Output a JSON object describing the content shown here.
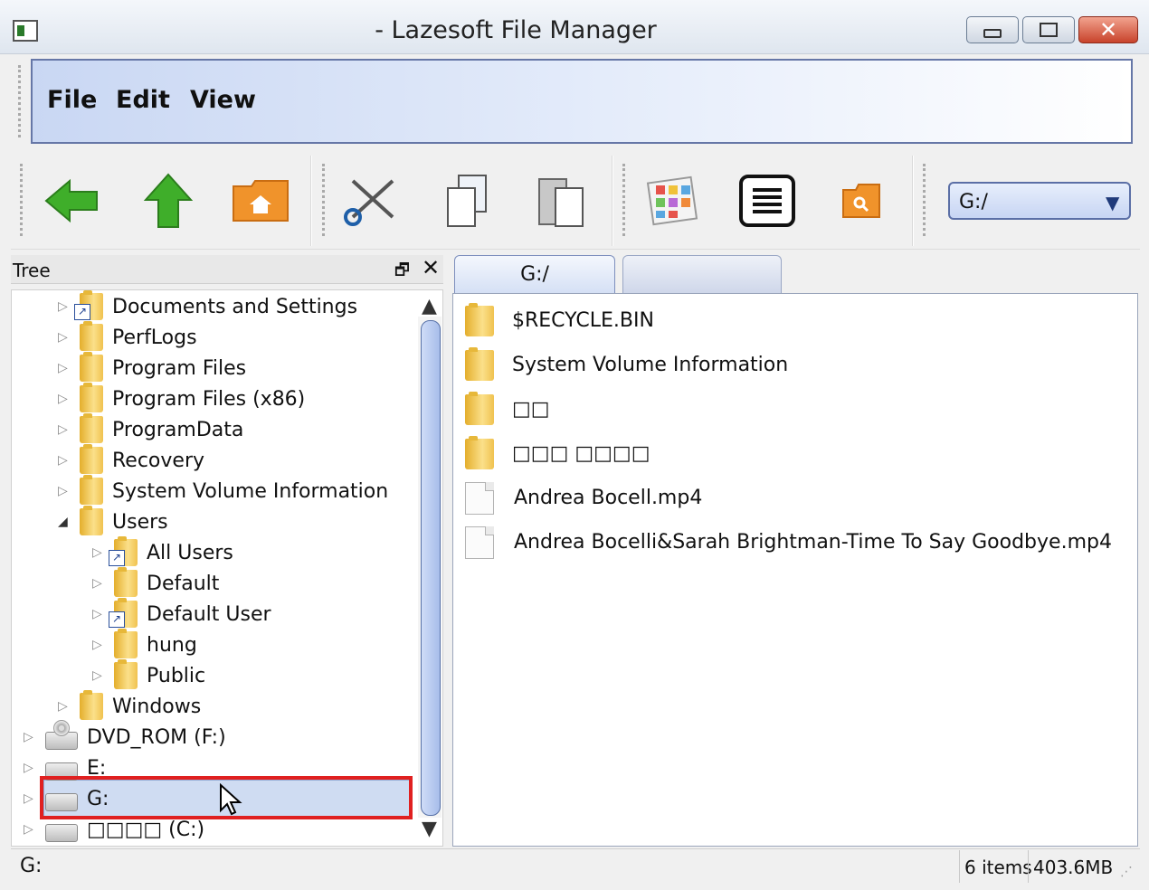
{
  "window": {
    "title": "- Lazesoft File Manager"
  },
  "menu": {
    "file": "File",
    "edit": "Edit",
    "view": "View"
  },
  "toolbar": {
    "buttons": [
      "back-icon",
      "up-icon",
      "home-folder-icon",
      "cut-icon",
      "copy-icon",
      "paste-icon",
      "thumbnail-view-icon",
      "list-view-icon",
      "search-folder-icon"
    ],
    "drive_combo_value": "G:/"
  },
  "tree": {
    "title": "Tree",
    "items": [
      {
        "label": "Documents and Settings",
        "icon": "folder-shortcut-icon"
      },
      {
        "label": "PerfLogs",
        "icon": "folder-icon"
      },
      {
        "label": "Program Files",
        "icon": "folder-icon"
      },
      {
        "label": "Program Files (x86)",
        "icon": "folder-icon"
      },
      {
        "label": "ProgramData",
        "icon": "folder-icon"
      },
      {
        "label": "Recovery",
        "icon": "folder-icon"
      },
      {
        "label": "System Volume Information",
        "icon": "folder-icon"
      },
      {
        "label": "Users",
        "icon": "folder-icon",
        "expanded": true
      },
      {
        "label": "All Users",
        "icon": "folder-shortcut-icon"
      },
      {
        "label": "Default",
        "icon": "folder-icon"
      },
      {
        "label": "Default User",
        "icon": "folder-shortcut-icon"
      },
      {
        "label": "hung",
        "icon": "folder-icon"
      },
      {
        "label": "Public",
        "icon": "folder-icon"
      },
      {
        "label": "Windows",
        "icon": "folder-icon"
      },
      {
        "label": "DVD_ROM (F:)",
        "icon": "dvd-drive-icon"
      },
      {
        "label": "E:",
        "icon": "drive-icon"
      },
      {
        "label": "G:",
        "icon": "drive-icon",
        "selected": true
      },
      {
        "label": "□□□□ (C:)",
        "icon": "drive-icon"
      }
    ]
  },
  "tabs": [
    {
      "label": "G:/"
    },
    {
      "label": ""
    }
  ],
  "files": [
    {
      "name": "$RECYCLE.BIN",
      "type": "folder"
    },
    {
      "name": "System Volume Information",
      "type": "folder"
    },
    {
      "name": "□□",
      "type": "folder"
    },
    {
      "name": "□□□ □□□□",
      "type": "folder"
    },
    {
      "name": "Andrea Bocell.mp4",
      "type": "file"
    },
    {
      "name": "Andrea Bocelli&Sarah Brightman-Time To Say Goodbye.mp4",
      "type": "file"
    }
  ],
  "status": {
    "path": "G:",
    "count": "6 items",
    "size": "403.6MB"
  },
  "colors": {
    "highlight_box": "#e02020",
    "selection": "#cfdcf2",
    "menubar_border": "#6677a7"
  }
}
